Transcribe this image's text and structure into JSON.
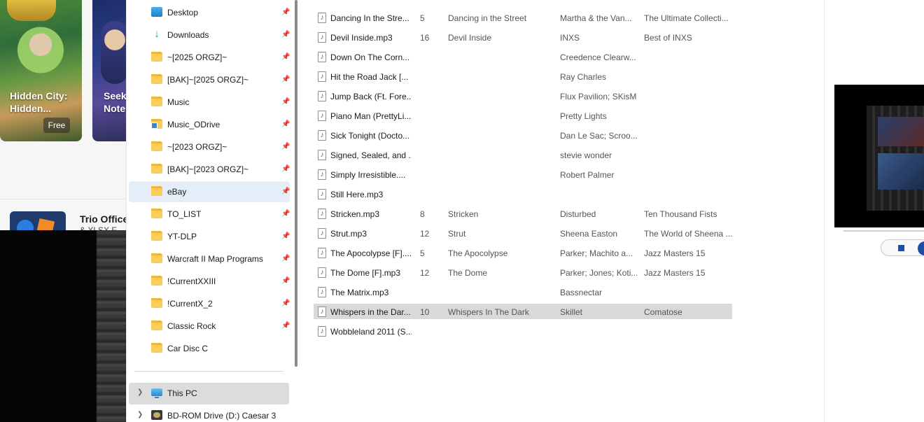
{
  "store": {
    "cards": [
      {
        "title": "Hidden City: Hidden...",
        "badge": "Free"
      },
      {
        "title": "Seeke Note"
      }
    ],
    "app": {
      "title": "Trio Office",
      "subtitle": "& XLSX F..."
    }
  },
  "nav": {
    "items": [
      {
        "label": "Desktop",
        "icon": "desktop-icon",
        "pinned": true
      },
      {
        "label": "Downloads",
        "icon": "download-icon",
        "pinned": true
      },
      {
        "label": "~[2025 ORGZ]~",
        "icon": "folder-icon",
        "pinned": true
      },
      {
        "label": "[BAK]~[2025 ORGZ]~",
        "icon": "folder-icon",
        "pinned": true
      },
      {
        "label": "Music",
        "icon": "folder-icon",
        "pinned": true
      },
      {
        "label": "Music_ODrive",
        "icon": "folder-shortcut-icon",
        "pinned": true
      },
      {
        "label": "~[2023 ORGZ]~",
        "icon": "folder-icon",
        "pinned": true
      },
      {
        "label": "[BAK]~[2023 ORGZ]~",
        "icon": "folder-icon",
        "pinned": true
      },
      {
        "label": "eBay",
        "icon": "folder-icon",
        "pinned": true,
        "selected": true
      },
      {
        "label": "TO_LIST",
        "icon": "folder-icon",
        "pinned": true
      },
      {
        "label": "YT-DLP",
        "icon": "folder-icon",
        "pinned": true
      },
      {
        "label": "Warcraft II Map Programs",
        "icon": "folder-icon",
        "pinned": true
      },
      {
        "label": "!CurrentXXIII",
        "icon": "folder-icon",
        "pinned": true
      },
      {
        "label": "!CurrentX_2",
        "icon": "folder-icon",
        "pinned": true
      },
      {
        "label": "Classic Rock",
        "icon": "folder-icon",
        "pinned": true
      },
      {
        "label": "Car Disc C",
        "icon": "folder-icon",
        "pinned": false
      }
    ],
    "this_pc": "This PC",
    "bd_drive": "BD-ROM Drive (D:) Caesar 3"
  },
  "files": {
    "rows": [
      {
        "name": "Dancing In the Stre...",
        "num": "5",
        "title": "Dancing in the Street",
        "artist": "Martha & the Van...",
        "album": "The Ultimate Collecti..."
      },
      {
        "name": "Devil Inside.mp3",
        "num": "16",
        "title": "Devil Inside",
        "artist": "INXS",
        "album": "Best of INXS"
      },
      {
        "name": "Down On The Corn...",
        "num": "",
        "title": "",
        "artist": "Creedence Clearw...",
        "album": ""
      },
      {
        "name": "Hit the Road Jack [...",
        "num": "",
        "title": "",
        "artist": "Ray Charles",
        "album": ""
      },
      {
        "name": "Jump Back (Ft. Fore...",
        "num": "",
        "title": "",
        "artist": "Flux Pavilion; SKisM",
        "album": ""
      },
      {
        "name": "Piano Man (PrettyLi...",
        "num": "",
        "title": "",
        "artist": "Pretty Lights",
        "album": ""
      },
      {
        "name": "Sick Tonight (Docto...",
        "num": "",
        "title": "",
        "artist": "Dan Le Sac; Scroo...",
        "album": ""
      },
      {
        "name": "Signed, Sealed, and ...",
        "num": "",
        "title": "",
        "artist": "stevie wonder",
        "album": ""
      },
      {
        "name": "Simply Irresistible....",
        "num": "",
        "title": "",
        "artist": "Robert Palmer",
        "album": ""
      },
      {
        "name": "Still Here.mp3",
        "num": "",
        "title": "",
        "artist": "",
        "album": ""
      },
      {
        "name": "Stricken.mp3",
        "num": "8",
        "title": "Stricken",
        "artist": "Disturbed",
        "album": "Ten Thousand Fists"
      },
      {
        "name": "Strut.mp3",
        "num": "12",
        "title": "Strut",
        "artist": "Sheena Easton",
        "album": "The World of Sheena ..."
      },
      {
        "name": "The Apocolypse [F]....",
        "num": "5",
        "title": "The Apocolypse",
        "artist": "Parker; Machito a...",
        "album": "Jazz Masters 15"
      },
      {
        "name": "The Dome [F].mp3",
        "num": "12",
        "title": "The Dome",
        "artist": "Parker; Jones; Koti...",
        "album": "Jazz Masters 15"
      },
      {
        "name": "The Matrix.mp3",
        "num": "",
        "title": "",
        "artist": "Bassnectar",
        "album": ""
      },
      {
        "name": "Whispers in the Dar...",
        "num": "10",
        "title": "Whispers In The Dark",
        "artist": "Skillet",
        "album": "Comatose",
        "selected": true
      },
      {
        "name": "Wobbleland 2011 (S...",
        "num": "",
        "title": "",
        "artist": "",
        "album": ""
      }
    ]
  },
  "colors": {
    "selection_nav": "#e5eef8",
    "selection_row": "#d9d9d9",
    "folder": "#f8cd5b",
    "accent": "#1d4fa8"
  }
}
